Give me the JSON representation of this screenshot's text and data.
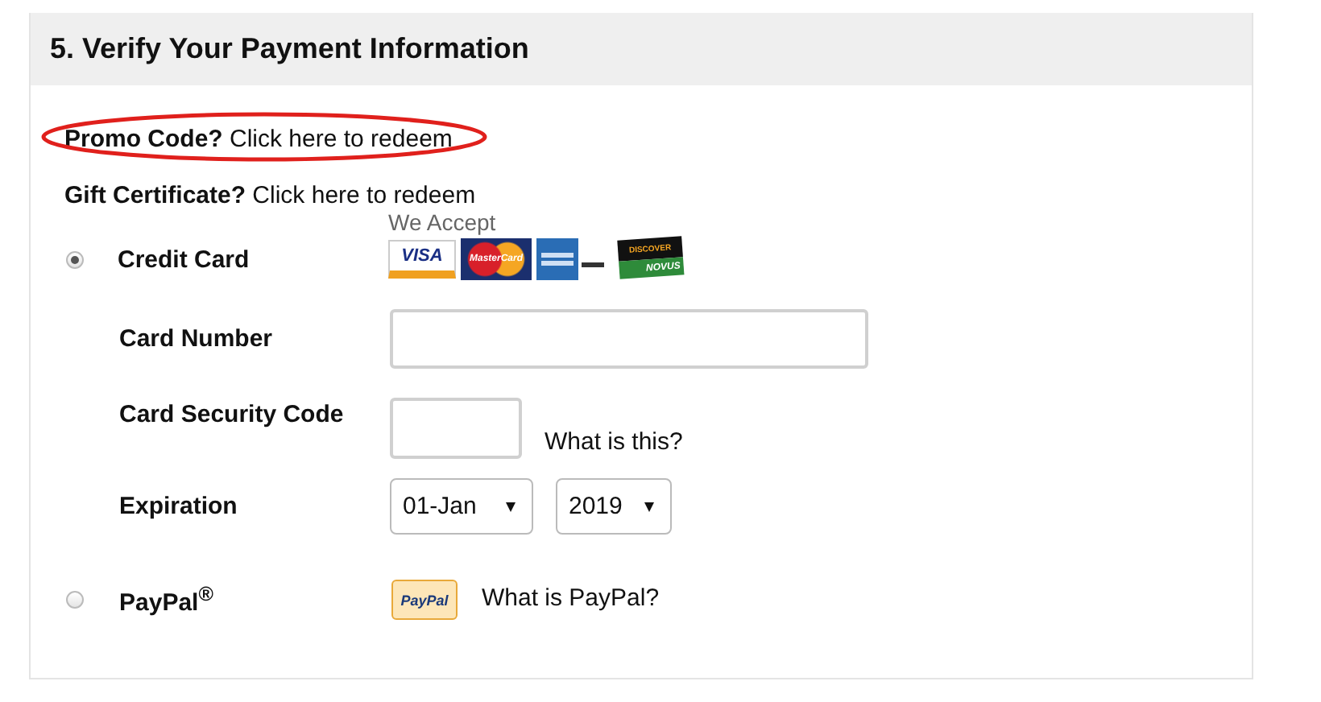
{
  "section": {
    "title": "5. Verify Your Payment Information"
  },
  "promo": {
    "label": "Promo Code?",
    "link": "Click here to redeem",
    "circled": true
  },
  "gift": {
    "label": "Gift Certificate?",
    "link": "Click here to redeem"
  },
  "payment_methods": [
    {
      "kind": "card",
      "label": "Credit Card",
      "selected": true,
      "accept_label": "We Accept",
      "cards": [
        {
          "kind": "visa",
          "text": "VISA"
        },
        {
          "kind": "mastercard",
          "text": "MasterCard"
        },
        {
          "kind": "amex"
        },
        {
          "kind": "discover",
          "text": "DISCOVER",
          "subtext": "NOVUS"
        }
      ],
      "fields": [
        {
          "kind": "text",
          "label": "Card Number"
        },
        {
          "kind": "short",
          "label": "Card Security Code",
          "help": "What is this?"
        },
        {
          "kind": "selects",
          "label": "Expiration",
          "selects": [
            {
              "value": "01-Jan"
            },
            {
              "value": "2019"
            }
          ]
        }
      ]
    },
    {
      "kind": "paypal",
      "label": "PayPal$^{®}$",
      "selected": false,
      "badge": "PayPal",
      "help": "What is PayPal?"
    }
  ]
}
